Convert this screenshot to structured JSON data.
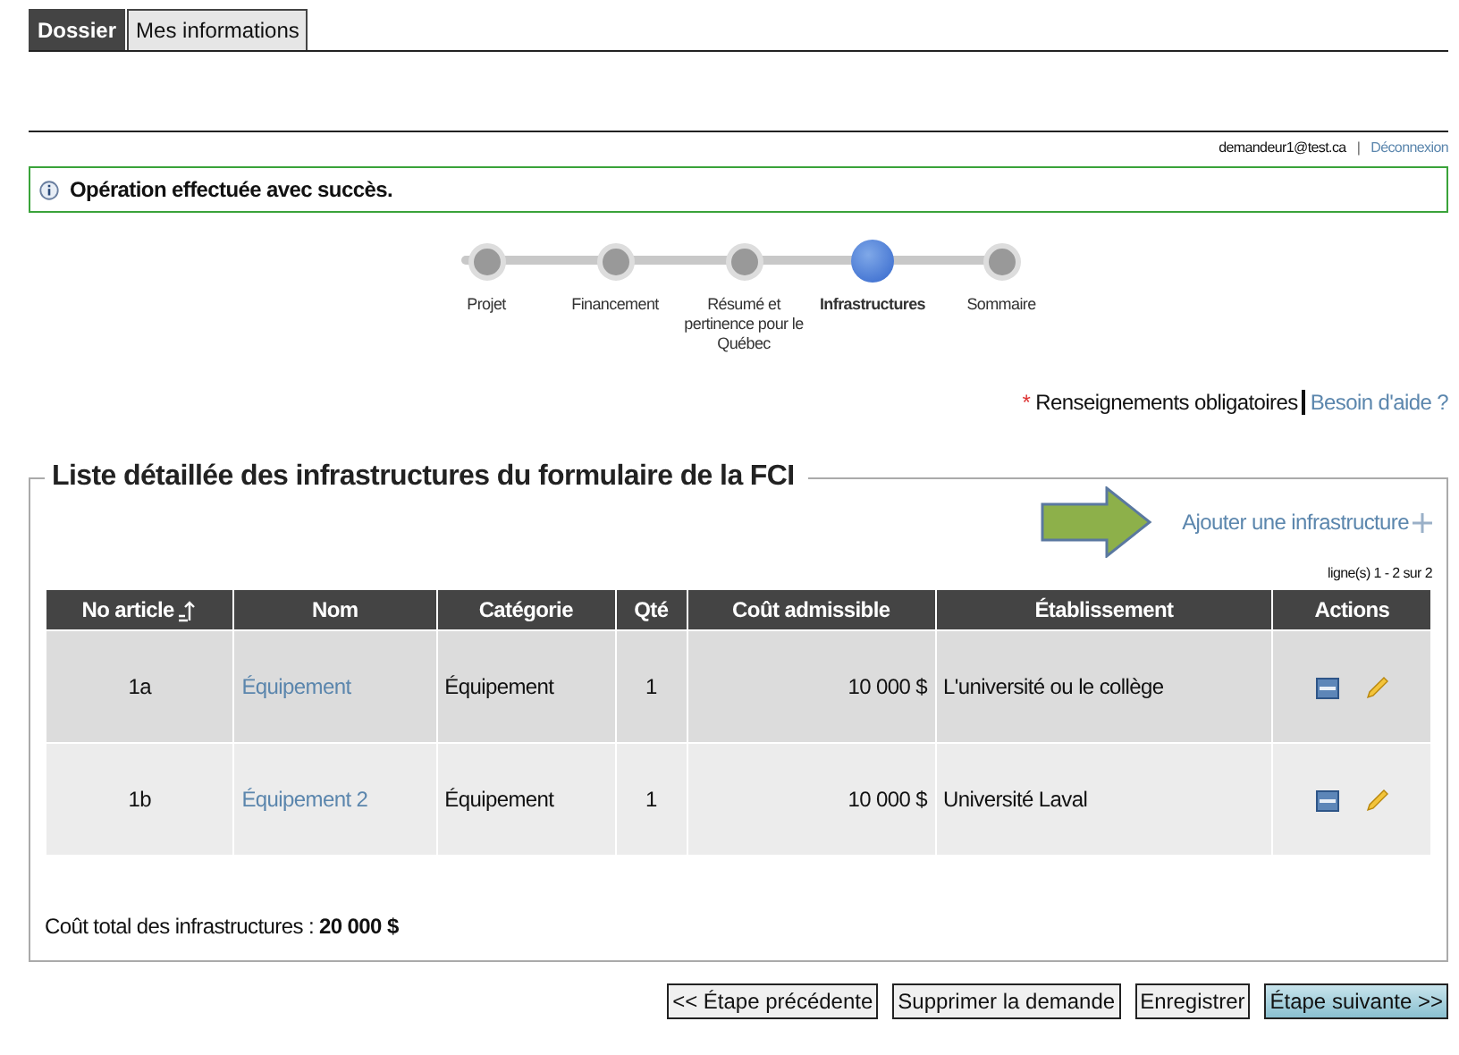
{
  "tabs": [
    {
      "label": "Dossier",
      "selected": true
    },
    {
      "label": "Mes informations",
      "selected": false
    }
  ],
  "user": {
    "email": "demandeur1@test.ca",
    "separator": "|",
    "logout": "Déconnexion"
  },
  "message": {
    "text": "Opération effectuée avec succès."
  },
  "steps": [
    {
      "label": "Projet",
      "selected": false
    },
    {
      "label": "Financement",
      "selected": false
    },
    {
      "label": "Résumé et pertinence pour le Québec",
      "selected": false
    },
    {
      "label": "Infrastructures",
      "selected": true
    },
    {
      "label": "Sommaire",
      "selected": false
    }
  ],
  "required": {
    "asterisk": "*",
    "text": "Renseignements obligatoires",
    "help": "Besoin d'aide ?"
  },
  "section": {
    "title": "Liste détaillée des infrastructures du formulaire de la FCI",
    "add_link": "Ajouter une infrastructure",
    "pager": "ligne(s) 1 - 2 sur 2"
  },
  "table": {
    "columns": [
      "No article",
      "Nom",
      "Catégorie",
      "Qté",
      "Coût admissible",
      "Établissement",
      "Actions"
    ],
    "rows": [
      {
        "no": "1a",
        "nom": "Équipement",
        "categorie": "Équipement",
        "qte": "1",
        "cout": "10 000 $",
        "etablissement": "L'université ou le collège"
      },
      {
        "no": "1b",
        "nom": "Équipement 2",
        "categorie": "Équipement",
        "qte": "1",
        "cout": "10 000 $",
        "etablissement": "Université Laval"
      }
    ]
  },
  "total": {
    "label": "Coût total des infrastructures : ",
    "value": "20 000 $"
  },
  "buttons": [
    {
      "label": "<< Étape précédente",
      "kind": "default"
    },
    {
      "label": "Supprimer la demande",
      "kind": "default"
    },
    {
      "label": "Enregistrer",
      "kind": "default"
    },
    {
      "label": "Étape suivante >>",
      "kind": "primary"
    }
  ]
}
